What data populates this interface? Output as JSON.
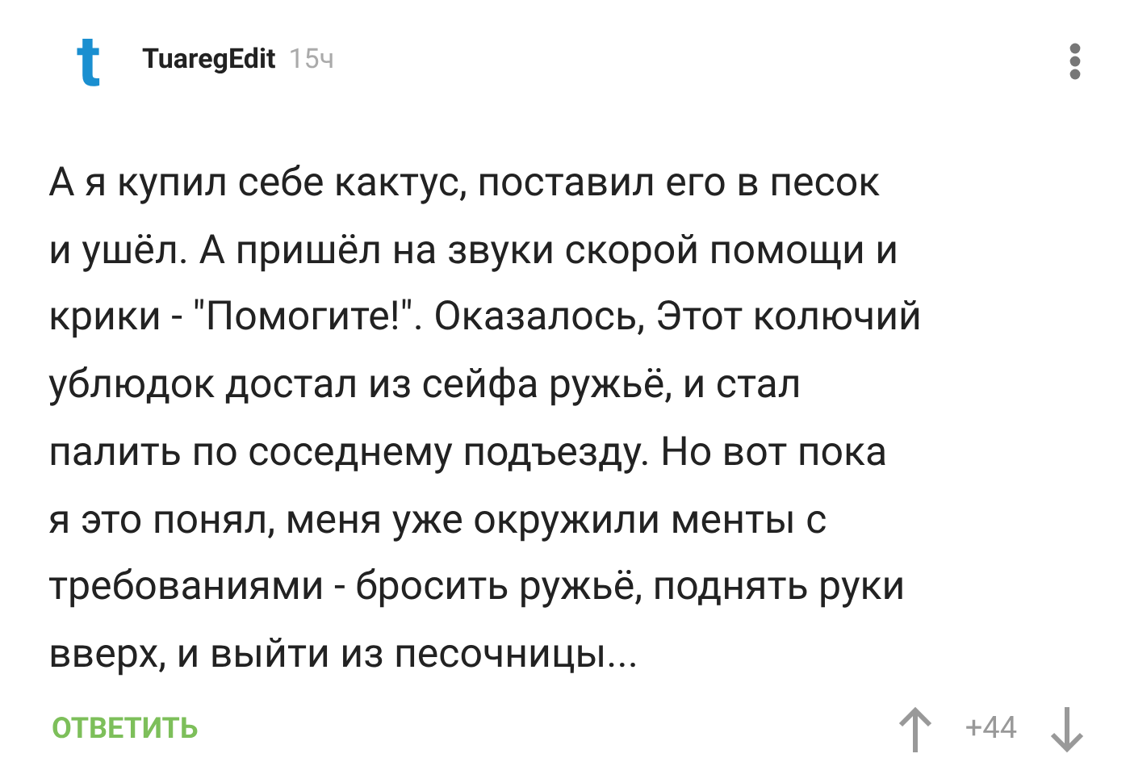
{
  "comment": {
    "avatar_letter": "t",
    "author": "TuaregEdit",
    "time": "15ч",
    "lines": [
      "А я купил себе кактус, поставил его в песок",
      "и ушёл. А пришёл на звуки скорой помощи и",
      "крики - \"Помогите!\". Оказалось, Этот колючий",
      "ублюдок достал из сейфа ружьё, и стал",
      "палить по соседнему подъезду. Но вот пока",
      "я это понял, меня уже окружили менты с",
      "требованиями - бросить ружьё, поднять руки",
      "вверх, и выйти из песочницы..."
    ],
    "reply": "ОТВЕТИТЬ",
    "rating": "+44"
  }
}
